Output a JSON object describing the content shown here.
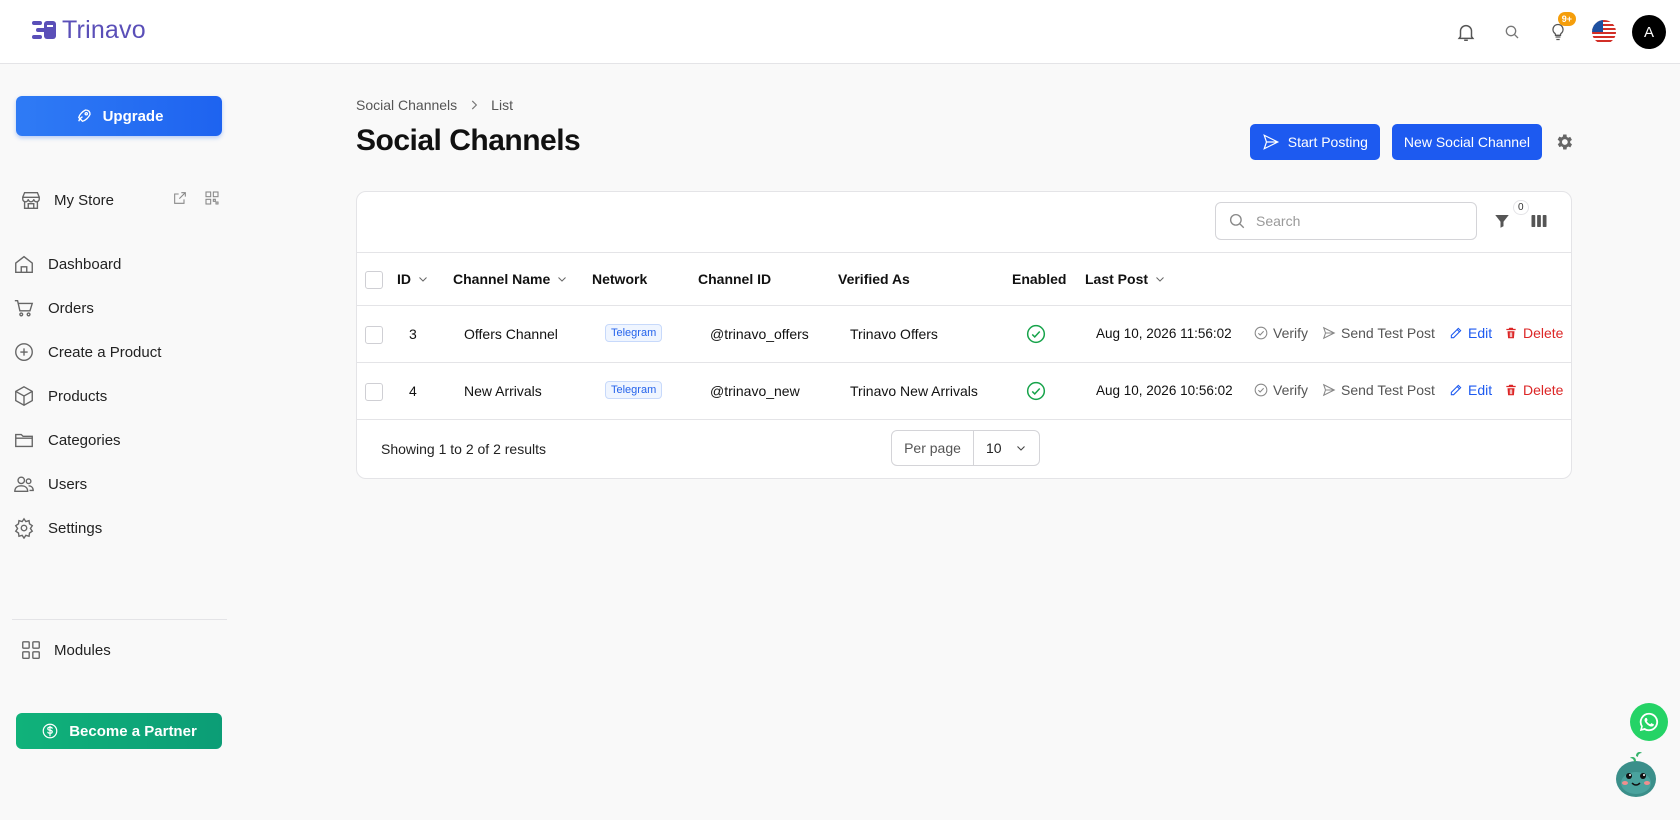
{
  "app": {
    "name": "Trinavo"
  },
  "topbar": {
    "notification_badge": "9+",
    "avatar_initial": "A"
  },
  "sidebar": {
    "upgrade_label": "Upgrade",
    "store_label": "My Store",
    "items": [
      {
        "label": "Dashboard",
        "icon": "home-icon"
      },
      {
        "label": "Orders",
        "icon": "cart-icon"
      },
      {
        "label": "Create a Product",
        "icon": "plus-circle-icon"
      },
      {
        "label": "Products",
        "icon": "box-icon"
      },
      {
        "label": "Categories",
        "icon": "folder-icon"
      },
      {
        "label": "Users",
        "icon": "users-icon"
      },
      {
        "label": "Settings",
        "icon": "gear-icon"
      }
    ],
    "modules_label": "Modules",
    "partner_label": "Become a Partner"
  },
  "breadcrumb": {
    "parent": "Social Channels",
    "current": "List"
  },
  "page": {
    "title": "Social Channels",
    "start_posting_label": "Start Posting",
    "new_channel_label": "New Social Channel"
  },
  "table": {
    "search_placeholder": "Search",
    "filter_count": "0",
    "headers": {
      "id": "ID",
      "channel_name": "Channel Name",
      "network": "Network",
      "channel_id": "Channel ID",
      "verified_as": "Verified As",
      "enabled": "Enabled",
      "last_post": "Last Post"
    },
    "actions": {
      "verify": "Verify",
      "test": "Send Test Post",
      "edit": "Edit",
      "delete": "Delete"
    },
    "rows": [
      {
        "id": "3",
        "channel_name": "Offers Channel",
        "network": "Telegram",
        "channel_id": "@trinavo_offers",
        "verified_as": "Trinavo Offers",
        "enabled": true,
        "last_post": "Aug 10, 2026 11:56:02"
      },
      {
        "id": "4",
        "channel_name": "New Arrivals",
        "network": "Telegram",
        "channel_id": "@trinavo_new",
        "verified_as": "Trinavo New Arrivals",
        "enabled": true,
        "last_post": "Aug 10, 2026 10:56:02"
      }
    ],
    "footer": {
      "summary": "Showing 1 to 2 of 2 results",
      "per_page_label": "Per page",
      "per_page_value": "10"
    }
  },
  "colors": {
    "primary": "#1d5af0",
    "danger": "#dc2626",
    "success": "#16a34a",
    "partner": "#10b27a",
    "brand": "#5a4fb8"
  }
}
